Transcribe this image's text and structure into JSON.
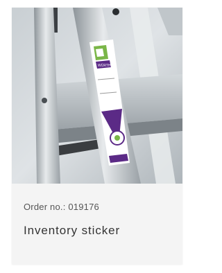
{
  "product": {
    "order_prefix": "Order no.: ",
    "order_number": "019176",
    "title": "Inventory sticker",
    "image_alt": "Inventory sticker on aluminium ladder"
  },
  "sticker": {
    "brand": "WÜRTH"
  },
  "colors": {
    "card_background": "#f4f4f4",
    "sticker_purple": "#5b2a86",
    "sticker_green": "#7ab648"
  }
}
